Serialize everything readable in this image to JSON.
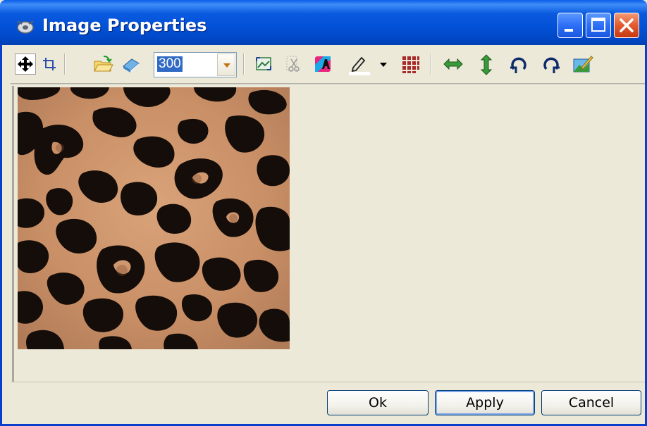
{
  "window": {
    "title": "Image Properties"
  },
  "toolbar": {
    "zoom_value": "300",
    "tools": [
      "move-tool-icon",
      "crop-tool-icon",
      "open-folder-icon",
      "eraser-icon",
      "zoom-value",
      "fit-image-icon",
      "scissors-icon",
      "text-color-icon",
      "pen-color-icon",
      "dropdown-arrow-icon",
      "grid-icon",
      "flip-horizontal-icon",
      "flip-vertical-icon",
      "rotate-left-icon",
      "rotate-right-icon",
      "color-adjust-icon"
    ]
  },
  "preview": {
    "image": "leopard-print-texture"
  },
  "buttons": {
    "ok": "Ok",
    "apply": "Apply",
    "cancel": "Cancel"
  },
  "colors": {
    "titlebar": "#0251d6",
    "face": "#ece9d8",
    "selection": "#316ac5",
    "close": "#e25a2d"
  }
}
